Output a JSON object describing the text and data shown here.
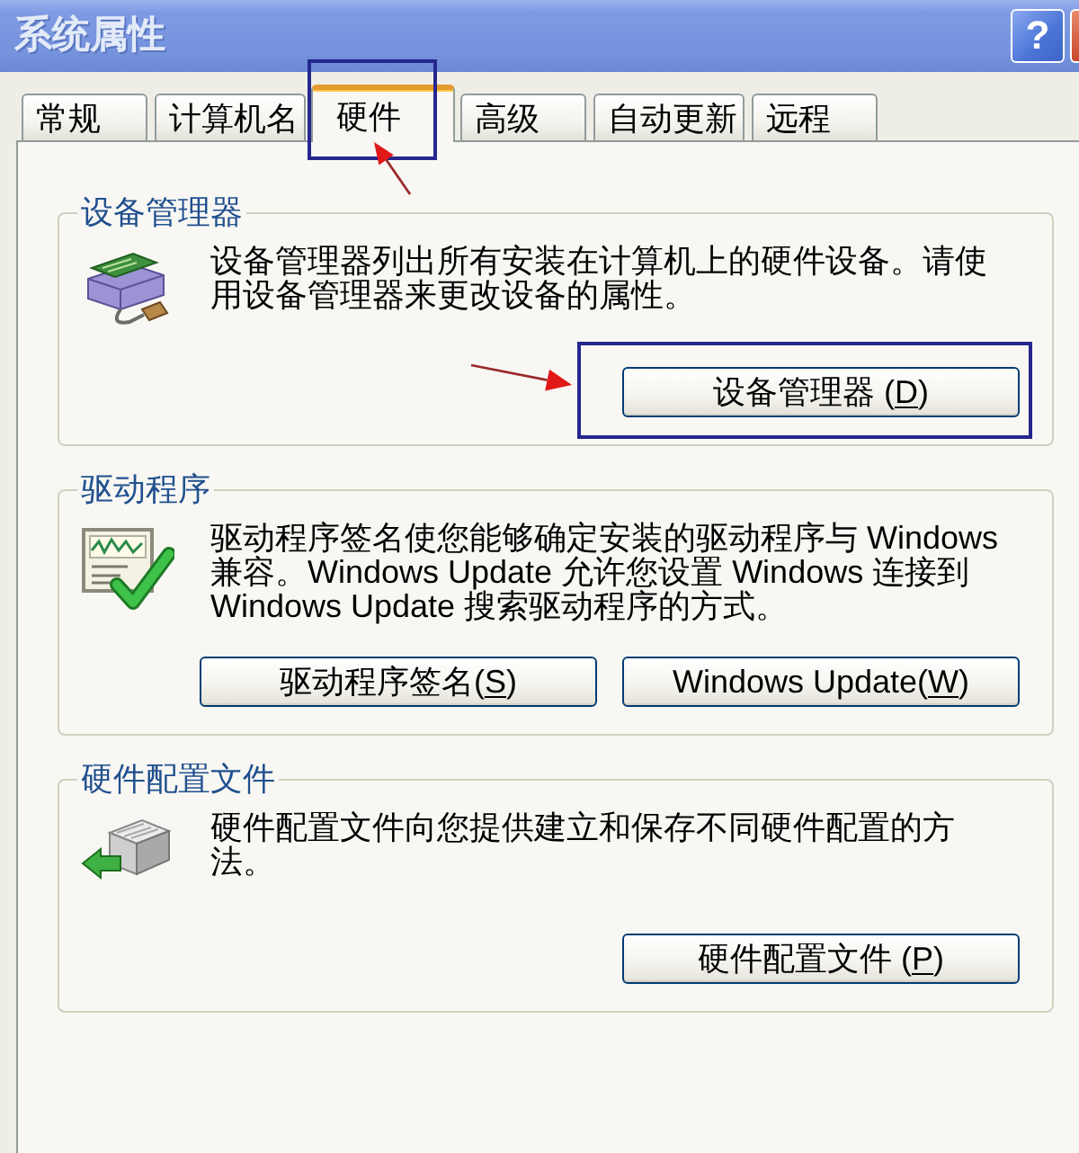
{
  "window": {
    "title": "系统属性",
    "help_button": "?"
  },
  "tabs": [
    {
      "label": "常规",
      "selected": false
    },
    {
      "label": "计算机名",
      "selected": false
    },
    {
      "label": "硬件",
      "selected": true
    },
    {
      "label": "高级",
      "selected": false
    },
    {
      "label": "自动更新",
      "selected": false
    },
    {
      "label": "远程",
      "selected": false
    }
  ],
  "groups": [
    {
      "title": "设备管理器",
      "description": "设备管理器列出所有安装在计算机上的硬件设备。请使用设备管理器来更改设备的属性。",
      "buttons": [
        {
          "label": "设备管理器 (",
          "access_key": "D",
          "label_end": ")"
        }
      ]
    },
    {
      "title": "驱动程序",
      "description": "驱动程序签名使您能够确定安装的驱动程序与 Windows 兼容。Windows Update 允许您设置 Windows 连接到 Windows Update 搜索驱动程序的方式。",
      "buttons": [
        {
          "label": "驱动程序签名(",
          "access_key": "S",
          "label_end": ")"
        },
        {
          "label": "Windows Update(",
          "access_key": "W",
          "label_end": ")"
        }
      ]
    },
    {
      "title": "硬件配置文件",
      "description": "硬件配置文件向您提供建立和保存不同硬件配置的方法。",
      "buttons": [
        {
          "label": "硬件配置文件 (",
          "access_key": "P",
          "label_end": ")"
        }
      ]
    }
  ]
}
